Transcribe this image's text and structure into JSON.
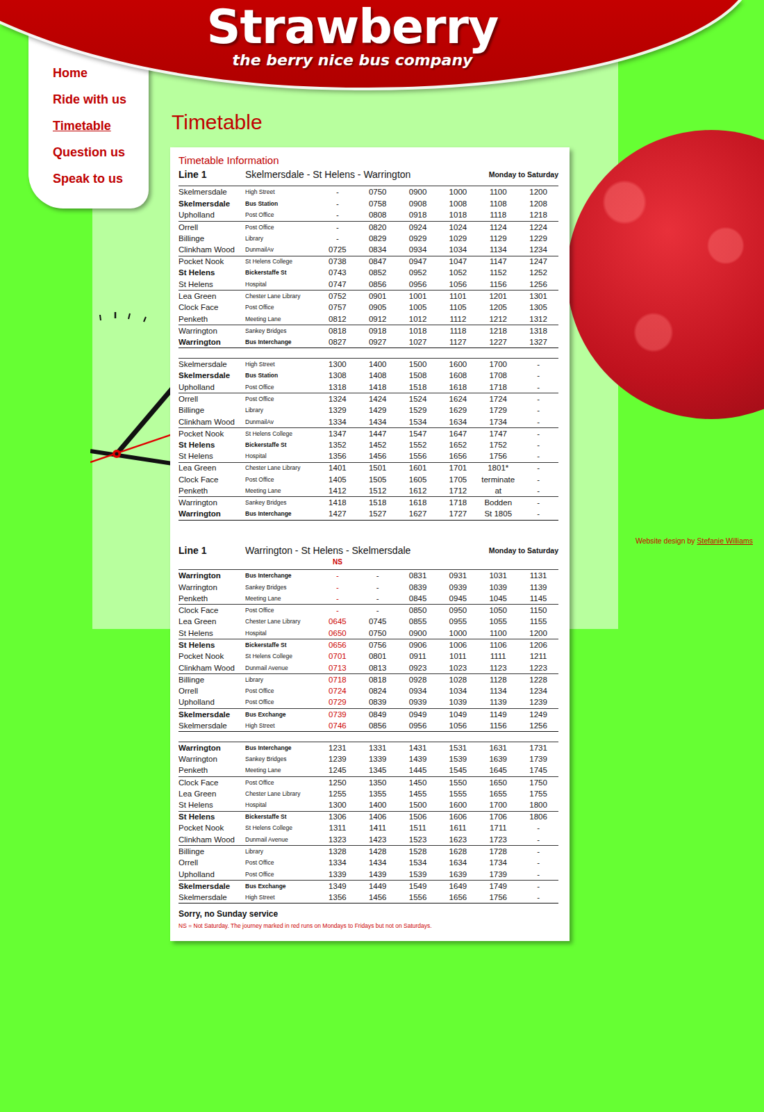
{
  "header": {
    "logo": "Strawberry",
    "tagline": "the berry nice bus company"
  },
  "nav": [
    {
      "label": "Home",
      "selected": false
    },
    {
      "label": "Ride with us",
      "selected": false
    },
    {
      "label": "Timetable",
      "selected": true
    },
    {
      "label": "Question us",
      "selected": false
    },
    {
      "label": "Speak to us",
      "selected": false
    }
  ],
  "page_title": "Timetable",
  "timetable": {
    "title": "Timetable Information",
    "sections": [
      {
        "line": "Line 1",
        "route": "Skelmersdale - St Helens - Warrington",
        "days": "Monday to Saturday",
        "stops": [
          {
            "name": "Skelmersdale",
            "place": "High Street",
            "bold": false
          },
          {
            "name": "Skelmersdale",
            "place": "Bus Station",
            "bold": true
          },
          {
            "name": "Upholland",
            "place": "Post Office",
            "bold": false
          },
          {
            "name": "Orrell",
            "place": "Post Office",
            "bold": false
          },
          {
            "name": "Billinge",
            "place": "Library",
            "bold": false
          },
          {
            "name": "Clinkham Wood",
            "place": "DunmailAv",
            "bold": false
          },
          {
            "name": "Pocket Nook",
            "place": "St Helens College",
            "bold": false
          },
          {
            "name": "St Helens",
            "place": "Bickerstaffe St",
            "bold": true
          },
          {
            "name": "St Helens",
            "place": "Hospital",
            "bold": false
          },
          {
            "name": "Lea Green",
            "place": "Chester Lane Library",
            "bold": false
          },
          {
            "name": "Clock Face",
            "place": "Post Office",
            "bold": false
          },
          {
            "name": "Penketh",
            "place": "Meeting Lane",
            "bold": false
          },
          {
            "name": "Warrington",
            "place": "Sankey Bridges",
            "bold": false
          },
          {
            "name": "Warrington",
            "place": "Bus Interchange",
            "bold": true
          }
        ],
        "blocks": [
          {
            "ns_columns": [
              false,
              false,
              false,
              false,
              false,
              false
            ],
            "times": [
              [
                "-",
                "0750",
                "0900",
                "1000",
                "1100",
                "1200"
              ],
              [
                "-",
                "0758",
                "0908",
                "1008",
                "1108",
                "1208"
              ],
              [
                "-",
                "0808",
                "0918",
                "1018",
                "1118",
                "1218"
              ],
              [
                "-",
                "0820",
                "0924",
                "1024",
                "1124",
                "1224"
              ],
              [
                "-",
                "0829",
                "0929",
                "1029",
                "1129",
                "1229"
              ],
              [
                "0725",
                "0834",
                "0934",
                "1034",
                "1134",
                "1234"
              ],
              [
                "0738",
                "0847",
                "0947",
                "1047",
                "1147",
                "1247"
              ],
              [
                "0743",
                "0852",
                "0952",
                "1052",
                "1152",
                "1252"
              ],
              [
                "0747",
                "0856",
                "0956",
                "1056",
                "1156",
                "1256"
              ],
              [
                "0752",
                "0901",
                "1001",
                "1101",
                "1201",
                "1301"
              ],
              [
                "0757",
                "0905",
                "1005",
                "1105",
                "1205",
                "1305"
              ],
              [
                "0812",
                "0912",
                "1012",
                "1112",
                "1212",
                "1312"
              ],
              [
                "0818",
                "0918",
                "1018",
                "1118",
                "1218",
                "1318"
              ],
              [
                "0827",
                "0927",
                "1027",
                "1127",
                "1227",
                "1327"
              ]
            ]
          },
          {
            "ns_columns": [
              false,
              false,
              false,
              false,
              false,
              false
            ],
            "times": [
              [
                "1300",
                "1400",
                "1500",
                "1600",
                "1700",
                "-"
              ],
              [
                "1308",
                "1408",
                "1508",
                "1608",
                "1708",
                "-"
              ],
              [
                "1318",
                "1418",
                "1518",
                "1618",
                "1718",
                "-"
              ],
              [
                "1324",
                "1424",
                "1524",
                "1624",
                "1724",
                "-"
              ],
              [
                "1329",
                "1429",
                "1529",
                "1629",
                "1729",
                "-"
              ],
              [
                "1334",
                "1434",
                "1534",
                "1634",
                "1734",
                "-"
              ],
              [
                "1347",
                "1447",
                "1547",
                "1647",
                "1747",
                "-"
              ],
              [
                "1352",
                "1452",
                "1552",
                "1652",
                "1752",
                "-"
              ],
              [
                "1356",
                "1456",
                "1556",
                "1656",
                "1756",
                "-"
              ],
              [
                "1401",
                "1501",
                "1601",
                "1701",
                "1801*",
                "-"
              ],
              [
                "1405",
                "1505",
                "1605",
                "1705",
                "terminate",
                "-"
              ],
              [
                "1412",
                "1512",
                "1612",
                "1712",
                "at",
                "-"
              ],
              [
                "1418",
                "1518",
                "1618",
                "1718",
                "Bodden",
                "-"
              ],
              [
                "1427",
                "1527",
                "1627",
                "1727",
                "St 1805",
                "-"
              ]
            ]
          }
        ]
      },
      {
        "line": "Line 1",
        "route": "Warrington - St Helens - Skelmersdale",
        "days": "Monday to Saturday",
        "ns_label": "NS",
        "stops": [
          {
            "name": "Warrington",
            "place": "Bus Interchange",
            "bold": true
          },
          {
            "name": "Warrington",
            "place": "Sankey Bridges",
            "bold": false
          },
          {
            "name": "Penketh",
            "place": "Meeting Lane",
            "bold": false
          },
          {
            "name": "Clock Face",
            "place": "Post Office",
            "bold": false
          },
          {
            "name": "Lea Green",
            "place": "Chester Lane Library",
            "bold": false
          },
          {
            "name": "St Helens",
            "place": "Hospital",
            "bold": false
          },
          {
            "name": "St Helens",
            "place": "Bickerstaffe St",
            "bold": true
          },
          {
            "name": "Pocket Nook",
            "place": "St Helens College",
            "bold": false
          },
          {
            "name": "Clinkham Wood",
            "place": "Dunmail Avenue",
            "bold": false
          },
          {
            "name": "Billinge",
            "place": "Library",
            "bold": false
          },
          {
            "name": "Orrell",
            "place": "Post Office",
            "bold": false
          },
          {
            "name": "Upholland",
            "place": "Post Office",
            "bold": false
          },
          {
            "name": "Skelmersdale",
            "place": "Bus Exchange",
            "bold": true
          },
          {
            "name": "Skelmersdale",
            "place": "High Street",
            "bold": false
          }
        ],
        "blocks": [
          {
            "ns_columns": [
              true,
              false,
              false,
              false,
              false,
              false
            ],
            "times": [
              [
                "-",
                "-",
                "0831",
                "0931",
                "1031",
                "1131"
              ],
              [
                "-",
                "-",
                "0839",
                "0939",
                "1039",
                "1139"
              ],
              [
                "-",
                "-",
                "0845",
                "0945",
                "1045",
                "1145"
              ],
              [
                "-",
                "-",
                "0850",
                "0950",
                "1050",
                "1150"
              ],
              [
                "0645",
                "0745",
                "0855",
                "0955",
                "1055",
                "1155"
              ],
              [
                "0650",
                "0750",
                "0900",
                "1000",
                "1100",
                "1200"
              ],
              [
                "0656",
                "0756",
                "0906",
                "1006",
                "1106",
                "1206"
              ],
              [
                "0701",
                "0801",
                "0911",
                "1011",
                "1111",
                "1211"
              ],
              [
                "0713",
                "0813",
                "0923",
                "1023",
                "1123",
                "1223"
              ],
              [
                "0718",
                "0818",
                "0928",
                "1028",
                "1128",
                "1228"
              ],
              [
                "0724",
                "0824",
                "0934",
                "1034",
                "1134",
                "1234"
              ],
              [
                "0729",
                "0839",
                "0939",
                "1039",
                "1139",
                "1239"
              ],
              [
                "0739",
                "0849",
                "0949",
                "1049",
                "1149",
                "1249"
              ],
              [
                "0746",
                "0856",
                "0956",
                "1056",
                "1156",
                "1256"
              ]
            ]
          },
          {
            "ns_columns": [
              false,
              false,
              false,
              false,
              false,
              false
            ],
            "times": [
              [
                "1231",
                "1331",
                "1431",
                "1531",
                "1631",
                "1731"
              ],
              [
                "1239",
                "1339",
                "1439",
                "1539",
                "1639",
                "1739"
              ],
              [
                "1245",
                "1345",
                "1445",
                "1545",
                "1645",
                "1745"
              ],
              [
                "1250",
                "1350",
                "1450",
                "1550",
                "1650",
                "1750"
              ],
              [
                "1255",
                "1355",
                "1455",
                "1555",
                "1655",
                "1755"
              ],
              [
                "1300",
                "1400",
                "1500",
                "1600",
                "1700",
                "1800"
              ],
              [
                "1306",
                "1406",
                "1506",
                "1606",
                "1706",
                "1806"
              ],
              [
                "1311",
                "1411",
                "1511",
                "1611",
                "1711",
                "-"
              ],
              [
                "1323",
                "1423",
                "1523",
                "1623",
                "1723",
                "-"
              ],
              [
                "1328",
                "1428",
                "1528",
                "1628",
                "1728",
                "-"
              ],
              [
                "1334",
                "1434",
                "1534",
                "1634",
                "1734",
                "-"
              ],
              [
                "1339",
                "1439",
                "1539",
                "1639",
                "1739",
                "-"
              ],
              [
                "1349",
                "1449",
                "1549",
                "1649",
                "1749",
                "-"
              ],
              [
                "1356",
                "1456",
                "1556",
                "1656",
                "1756",
                "-"
              ]
            ]
          }
        ]
      }
    ],
    "footer_note": "Sorry, no Sunday service",
    "ns_note": "NS = Not Saturday. The journey marked in red runs on Mondays to Fridays but not on Saturdays."
  },
  "credit": {
    "prefix": "Website design by",
    "author": "Stefanie Williams"
  }
}
